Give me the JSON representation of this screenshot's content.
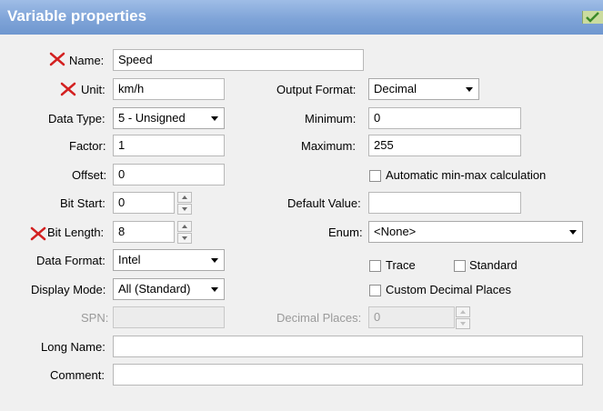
{
  "window": {
    "title": "Variable properties"
  },
  "colors": {
    "title_bar": "#7fa4d8",
    "required_mark": "#d32020"
  },
  "fields": {
    "name": {
      "label": "Name:",
      "value": "Speed"
    },
    "unit": {
      "label": "Unit:",
      "value": "km/h"
    },
    "data_type": {
      "label": "Data Type:",
      "value": "5 - Unsigned"
    },
    "factor": {
      "label": "Factor:",
      "value": "1"
    },
    "offset": {
      "label": "Offset:",
      "value": "0"
    },
    "bit_start": {
      "label": "Bit Start:",
      "value": "0"
    },
    "bit_length": {
      "label": "Bit Length:",
      "value": "8"
    },
    "data_format": {
      "label": "Data Format:",
      "value": "Intel"
    },
    "display_mode": {
      "label": "Display Mode:",
      "value": "All (Standard)"
    },
    "spn": {
      "label": "SPN:",
      "value": ""
    },
    "long_name": {
      "label": "Long Name:",
      "value": ""
    },
    "comment": {
      "label": "Comment:",
      "value": ""
    },
    "output_format": {
      "label": "Output Format:",
      "value": "Decimal"
    },
    "minimum": {
      "label": "Minimum:",
      "value": "0"
    },
    "maximum": {
      "label": "Maximum:",
      "value": "255"
    },
    "auto_minmax": {
      "label": "Automatic min-max calculation",
      "checked": false
    },
    "default_value": {
      "label": "Default Value:",
      "value": ""
    },
    "enum": {
      "label": "Enum:",
      "value": "<None>"
    },
    "trace": {
      "label": "Trace",
      "checked": false
    },
    "standard": {
      "label": "Standard",
      "checked": false
    },
    "custom_decimal": {
      "label": "Custom Decimal Places",
      "checked": false
    },
    "decimal_places": {
      "label": "Decimal Places:",
      "value": "0"
    }
  },
  "icons": {
    "required": "red-x-icon",
    "apply": "green-check-icon"
  }
}
